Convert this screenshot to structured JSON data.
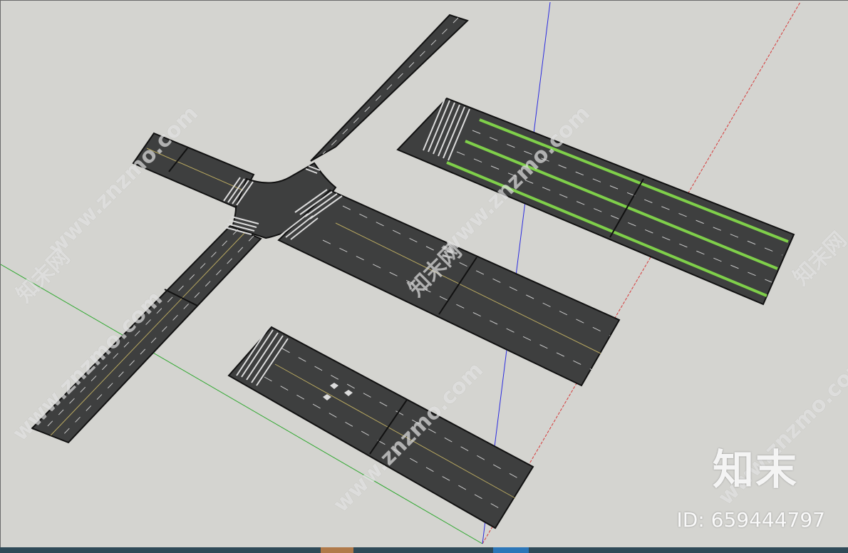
{
  "watermark": {
    "site": "www.znzmo.com",
    "brand": "知末网",
    "logo": "知末",
    "id_text": "ID: 659444797"
  },
  "colors": {
    "ground": "#d4d4d0",
    "asphalt": "#3e3f3f",
    "road_edge": "#111111",
    "lane_line": "#c9c9c9",
    "center_line": "#b8a860",
    "green_lane": "#7fcf4a",
    "axis_red": "#d63a3a",
    "axis_green": "#2fa82f",
    "axis_blue": "#2a2ae0",
    "taskbar": "#2f4a58"
  },
  "scene": {
    "objects": [
      {
        "name": "road-cross-intersection",
        "type": "road-segment"
      },
      {
        "name": "road-segment-green-bike-lanes",
        "type": "road-segment"
      },
      {
        "name": "road-segment-crosswalk-arrows",
        "type": "road-segment"
      },
      {
        "name": "axis-red",
        "type": "axis"
      },
      {
        "name": "axis-green",
        "type": "axis"
      },
      {
        "name": "axis-blue",
        "type": "axis"
      }
    ]
  },
  "taskbar": {
    "icons": [
      "taskbar-app-icon",
      "taskbar-app-icon-active"
    ]
  }
}
